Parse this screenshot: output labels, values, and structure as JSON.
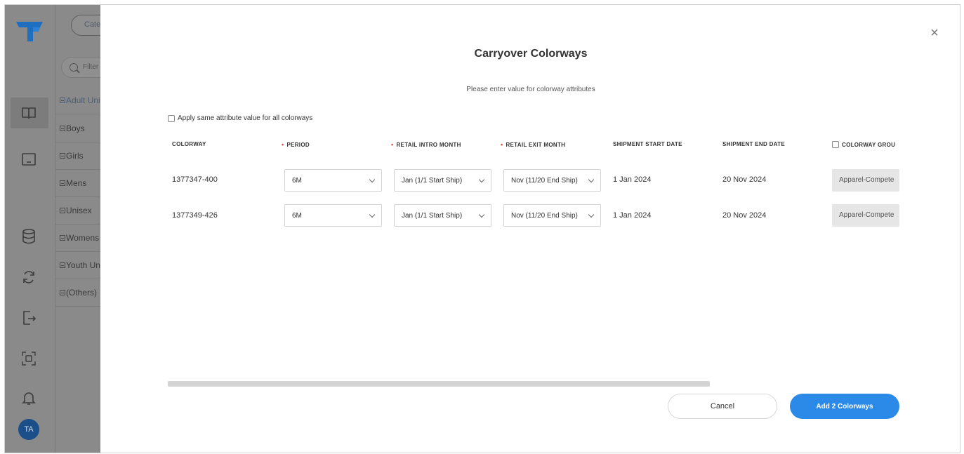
{
  "sidebar": {
    "avatar_initials": "TA",
    "icons": [
      "logo-icon",
      "book-icon",
      "monitor-icon",
      "database-icon",
      "sync-icon",
      "export-icon",
      "scan-icon",
      "bell-icon"
    ]
  },
  "filter_panel": {
    "category_pill": "Categ",
    "filter_placeholder": "Filter",
    "tree_items": [
      "Adult Uni",
      "Boys",
      "Girls",
      "Mens",
      "Unisex",
      "Womens",
      "Youth Un",
      "(Others)"
    ]
  },
  "modal": {
    "title": "Carryover Colorways",
    "subtitle": "Please enter value for colorway attributes",
    "apply_same_label": "Apply same attribute value for all colorways",
    "columns": {
      "colorway": "COLORWAY",
      "period": "PERIOD",
      "retail_intro": "RETAIL INTRO MONTH",
      "retail_exit": "RETAIL EXIT MONTH",
      "ship_start": "SHIPMENT START DATE",
      "ship_end": "SHIPMENT END DATE",
      "group": "COLORWAY GROU"
    },
    "rows": [
      {
        "colorway": "1377347-400",
        "period": "6M",
        "intro": "Jan (1/1 Start Ship)",
        "exit": "Nov (11/20 End Ship)",
        "ship_start": "1 Jan 2024",
        "ship_end": "20 Nov 2024",
        "group": "Apparel-Compete"
      },
      {
        "colorway": "1377349-426",
        "period": "6M",
        "intro": "Jan (1/1 Start Ship)",
        "exit": "Nov (11/20 End Ship)",
        "ship_start": "1 Jan 2024",
        "ship_end": "20 Nov 2024",
        "group": "Apparel-Compete"
      }
    ],
    "cancel_label": "Cancel",
    "add_label": "Add 2 Colorways",
    "close_glyph": "×"
  },
  "colors": {
    "accent": "#2b8ae8",
    "required": "#e0443c",
    "brand": "#1f6fc0"
  }
}
